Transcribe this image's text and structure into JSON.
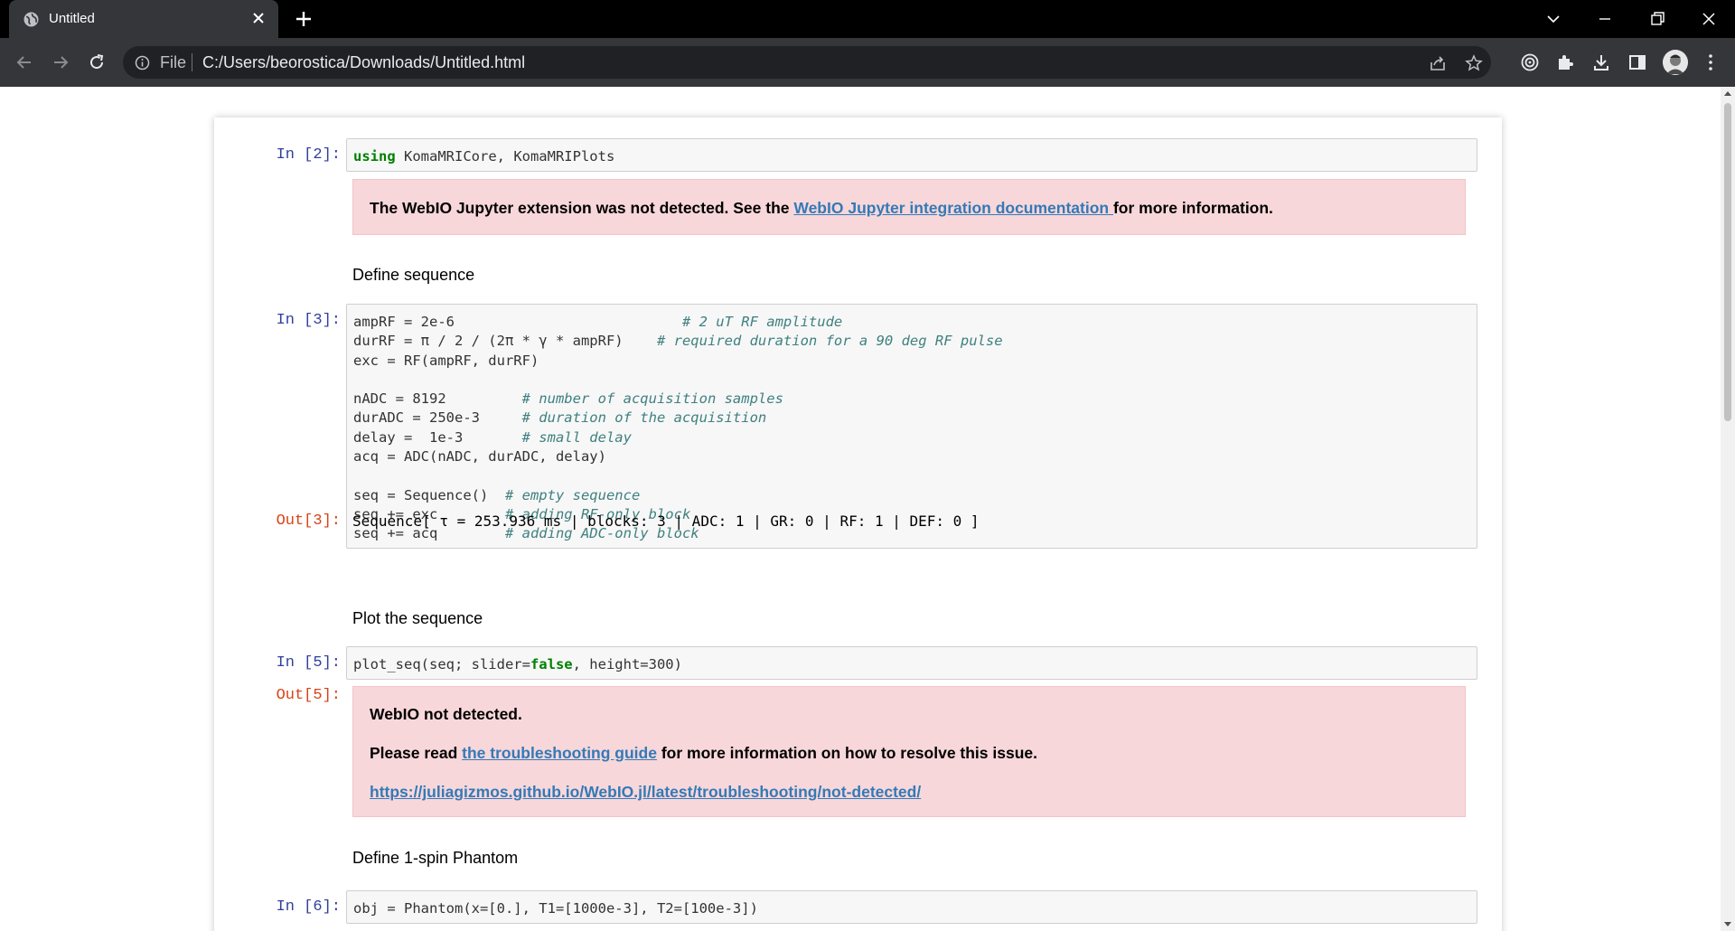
{
  "browser": {
    "tab_title": "Untitled",
    "address_file_label": "File",
    "address_url": "C:/Users/beorostica/Downloads/Untitled.html"
  },
  "cells": {
    "c1": {
      "prompt": "In [2]:",
      "code_keyword": "using",
      "code_rest": " KomaMRICore, KomaMRIPlots",
      "warning_text_before": "The WebIO Jupyter extension was not detected. See the ",
      "warning_link": "WebIO Jupyter integration documentation ",
      "warning_text_after": "for more information."
    },
    "md1": "Define sequence",
    "c2": {
      "prompt": "In [3]:",
      "out_prompt": "Out[3]:",
      "lines": [
        {
          "code": "ampRF = 2e-6",
          "pad": "                           ",
          "comment": "# 2 uT RF amplitude"
        },
        {
          "code": "durRF = π / 2 / (2π * γ * ampRF)",
          "pad": "    ",
          "comment": "# required duration for a 90 deg RF pulse"
        },
        {
          "code": "exc = RF(ampRF, durRF)",
          "pad": "",
          "comment": ""
        },
        {
          "code": "",
          "pad": "",
          "comment": ""
        },
        {
          "code": "nADC = 8192",
          "pad": "         ",
          "comment": "# number of acquisition samples"
        },
        {
          "code": "durADC = 250e-3",
          "pad": "     ",
          "comment": "# duration of the acquisition"
        },
        {
          "code": "delay =  1e-3",
          "pad": "       ",
          "comment": "# small delay"
        },
        {
          "code": "acq = ADC(nADC, durADC, delay)",
          "pad": "",
          "comment": ""
        },
        {
          "code": "",
          "pad": "",
          "comment": ""
        },
        {
          "code": "seq = Sequence()",
          "pad": "  ",
          "comment": "# empty sequence"
        },
        {
          "code": "seq += exc",
          "pad": "        ",
          "comment": "# adding RF-only block"
        },
        {
          "code": "seq += acq",
          "pad": "        ",
          "comment": "# adding ADC-only block"
        }
      ],
      "output": "Sequence[ τ = 253.936 ms | blocks: 3 | ADC: 1 | GR: 0 | RF: 1 | DEF: 0 ]"
    },
    "md2": "Plot the sequence",
    "c3": {
      "prompt": "In [5]:",
      "out_prompt": "Out[5]:",
      "code_a": "plot_seq(seq; slider=",
      "code_kw": "false",
      "code_b": ", height=300)",
      "alert_title": "WebIO not detected.",
      "alert_text_before": "Please read ",
      "alert_link": "the troubleshooting guide",
      "alert_text_after": " for more information on how to resolve this issue.",
      "alert_url": "https://juliagizmos.github.io/WebIO.jl/latest/troubleshooting/not-detected/"
    },
    "md3": "Define 1-spin Phantom",
    "c4": {
      "prompt": "In [6]:",
      "code": "obj = Phantom(x=[0.], T1=[1000e-3], T2=[100e-3])"
    }
  }
}
